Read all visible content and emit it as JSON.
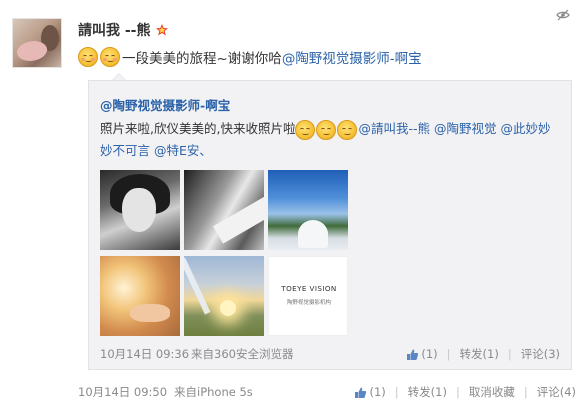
{
  "post": {
    "author": "請叫我 --熊",
    "text_tail": "一段美美的旅程~谢谢你哈",
    "mention": "@陶野视觉摄影师-啊宝",
    "time": "10月14日 09:50",
    "source": "来自iPhone 5s",
    "actions": {
      "like_count": "(1)",
      "repost": "转发(1)",
      "unfavorite": "取消收藏",
      "comment": "评论(4)"
    }
  },
  "repost": {
    "author": "@陶野视觉摄影师-啊宝",
    "text_start": "照片来啦,欣仪美美的,快来收照片啦",
    "mention_1": "@請叫我--熊",
    "mention_2": "@陶野视觉",
    "mention_3": "@此妙妙妙不可言",
    "mention_4": "@特E安、",
    "time": "10月14日 09:36",
    "source": "来自360安全浏览器",
    "actions": {
      "like_count": "(1)",
      "repost": "转发(1)",
      "comment": "评论(3)"
    },
    "thumbnail_brand": "TOEYE VISION",
    "thumbnail_brand_sub": "陶野视觉摄影机构"
  },
  "icons": {
    "vip_badge": "vip-badge-icon",
    "hide": "hide-icon",
    "like": "thumbs-up-icon",
    "emoji": "smiley-emoji-icon"
  },
  "colors": {
    "link": "#2b62a8",
    "meta": "#8a8a8a",
    "repost_bg": "#f2f2f5"
  }
}
